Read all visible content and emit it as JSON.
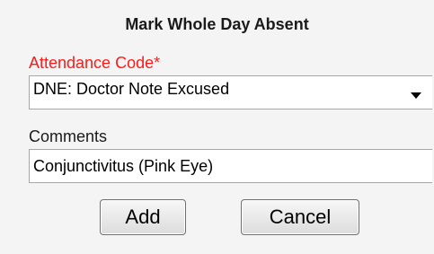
{
  "dialog": {
    "title": "Mark Whole Day Absent"
  },
  "attendance_code": {
    "label": "Attendance Code*",
    "selected": "DNE: Doctor Note Excused",
    "label_color": "#ff1a1a"
  },
  "comments": {
    "label": "Comments",
    "value": "Conjunctivitus (Pink Eye)"
  },
  "buttons": {
    "add_label": "Add",
    "cancel_label": "Cancel"
  }
}
